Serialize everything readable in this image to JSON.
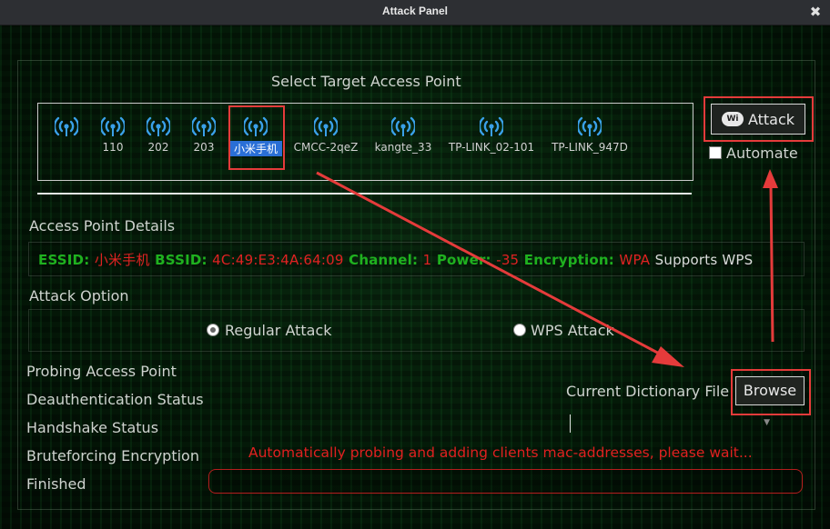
{
  "window": {
    "title": "Attack Panel",
    "close_glyph": "✖"
  },
  "target_section": {
    "title": "Select Target Access Point"
  },
  "access_points": [
    {
      "name": "",
      "icon": "wifi-icon"
    },
    {
      "name": "110",
      "icon": "wifi-icon"
    },
    {
      "name": "202",
      "icon": "wifi-icon"
    },
    {
      "name": "203",
      "icon": "wifi-icon"
    },
    {
      "name": "小米手机",
      "icon": "wifi-icon",
      "selected": true
    },
    {
      "name": "CMCC-2qeZ",
      "icon": "wifi-icon"
    },
    {
      "name": "kangte_33",
      "icon": "wifi-icon"
    },
    {
      "name": "TP-LINK_02-101",
      "icon": "wifi-icon"
    },
    {
      "name": "TP-LINK_947D",
      "icon": "wifi-icon"
    }
  ],
  "attack_button": {
    "label": "Attack",
    "icon_text": "Wi"
  },
  "automate": {
    "label": "Automate",
    "checked": false
  },
  "details": {
    "title": "Access Point Details",
    "essid_label": "ESSID:",
    "essid": "小米手机",
    "bssid_label": "BSSID:",
    "bssid": "4C:49:E3:4A:64:09",
    "channel_label": "Channel:",
    "channel": "1",
    "power_label": "Power:",
    "power": "-35",
    "encryption_label": "Encryption:",
    "encryption": "WPA",
    "wps_text": "Supports WPS"
  },
  "attack_option": {
    "title": "Attack Option",
    "regular": "Regular Attack",
    "wps": "WPS  Attack",
    "selected": "regular"
  },
  "status_steps": [
    "Probing Access Point",
    "Deauthentication Status",
    "Handshake Status",
    "Bruteforcing Encryption",
    "Finished"
  ],
  "dictionary": {
    "label": "Current Dictionary File",
    "browse": "Browse",
    "value": ""
  },
  "status_message": "Automatically probing and adding clients mac-addresses, please wait...",
  "colors": {
    "annotation_red": "#e53b3b",
    "label_green": "#1fb11f",
    "value_red": "#e02222",
    "selection_blue": "#2a6fd6"
  }
}
